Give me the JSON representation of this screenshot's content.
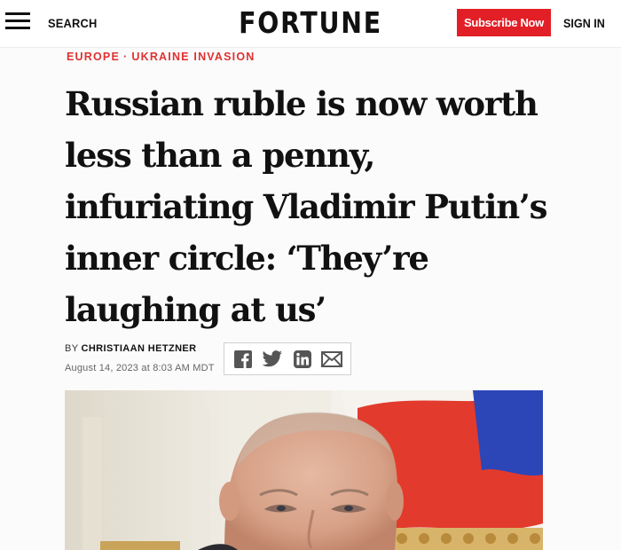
{
  "header": {
    "search_label": "SEARCH",
    "logo_text": "FORTUNE",
    "subscribe_label": "Subscribe Now",
    "signin_label": "SIGN IN"
  },
  "article": {
    "kicker": {
      "section": "EUROPE",
      "separator": "·",
      "topic": "UKRAINE INVASION"
    },
    "headline": "Russian ruble is now worth less than a penny, infuriating Vladimir Putin’s inner circle: ‘They’re laughing at us’",
    "byline_prefix": "BY",
    "author": "CHRISTIAAN HETZNER",
    "date": "August 14, 2023 at 8:03 AM MDT"
  },
  "share": {
    "icons": [
      "facebook-icon",
      "twitter-icon",
      "linkedin-icon",
      "email-icon"
    ]
  },
  "colors": {
    "brand_red": "#e21f26",
    "kicker_red": "#e03131",
    "text": "#111111"
  }
}
